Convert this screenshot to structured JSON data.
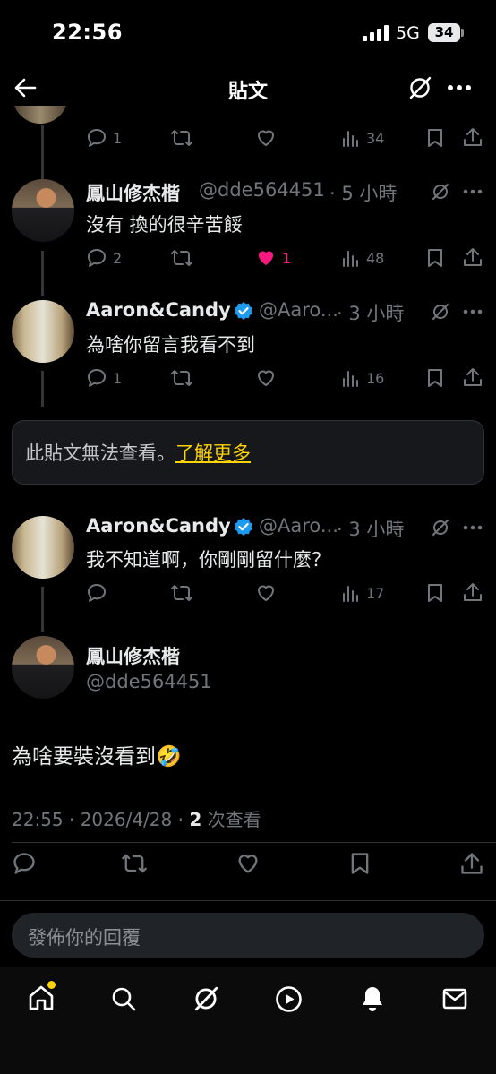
{
  "status_bar": {
    "time": "22:56",
    "network": "5G",
    "battery": "34"
  },
  "header": {
    "title": "貼文"
  },
  "replies": [
    {
      "stats": {
        "replies": "1",
        "likes": "",
        "views": "34"
      }
    },
    {
      "author": "鳳山修杰楷",
      "handle": "@dde564451",
      "time": "· 5 小時",
      "text": "沒有 換的很辛苦餒",
      "stats": {
        "replies": "2",
        "likes": "1",
        "views": "48"
      }
    },
    {
      "author": "Aaron&Candy",
      "handle": "@Aaro...",
      "time": "· 3 小時",
      "text": "為啥你留言我看不到",
      "stats": {
        "replies": "1",
        "likes": "",
        "views": "16"
      }
    },
    {
      "author": "Aaron&Candy",
      "handle": "@Aaro...",
      "time": "· 3 小時",
      "text": "我不知道啊，你剛剛留什麼？",
      "stats": {
        "replies": "",
        "likes": "",
        "views": "17"
      }
    }
  ],
  "unavailable_notice": {
    "text": "此貼文無法查看。",
    "link": "了解更多"
  },
  "main_post": {
    "author": "鳳山修杰楷",
    "handle": "@dde564451",
    "text": "為啥要裝沒看到",
    "emoji": "🤣",
    "timestamp": "22:55 · 2026/4/28 · ",
    "views_count": "2",
    "views_label": " 次查看"
  },
  "reply_input": {
    "placeholder": "發佈你的回覆"
  },
  "colors": {
    "background": "#000000",
    "accent_verified": "#1d9bf0",
    "like_pink": "#f91880",
    "link_yellow": "#ffd400"
  },
  "icons": [
    "back-arrow-icon",
    "grok-icon",
    "more-icon",
    "reply-icon",
    "repost-icon",
    "like-icon",
    "views-icon",
    "bookmark-icon",
    "share-icon",
    "verified-badge-icon",
    "home-icon",
    "search-icon",
    "play-icon",
    "bell-icon",
    "mail-icon"
  ]
}
